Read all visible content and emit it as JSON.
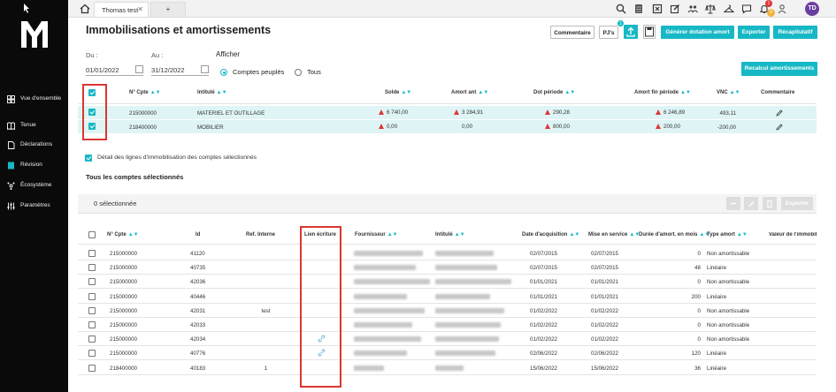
{
  "app": {
    "tab_title": "Thomas test",
    "tab_close": "✕",
    "tab_add": "+",
    "avatar_initials": "TD",
    "badge_notifications": "1",
    "badge_user": "0",
    "badge_pjs": "1"
  },
  "nav": [
    {
      "label": "Vue d'ensemble",
      "icon": "grid-icon"
    },
    {
      "label": "Tenue",
      "icon": "book-icon"
    },
    {
      "label": "Déclarations",
      "icon": "document-icon"
    },
    {
      "label": "Révision",
      "icon": "revision-icon"
    },
    {
      "label": "Écosystème",
      "icon": "ecosystem-icon"
    },
    {
      "label": "Paramètres",
      "icon": "sliders-icon"
    }
  ],
  "page": {
    "title": "Immobilisations et amortissements",
    "buttons": {
      "commentaire": "Commentaire",
      "pjs": "PJ's",
      "generer": "Générer dotation amort",
      "exporter": "Exporter",
      "recapitulatif": "Récapitulatif",
      "recalcul": "Recalcul amortissements"
    },
    "filters": {
      "du_label": "Du :",
      "au_label": "Au :",
      "du_value": "01/01/2022",
      "au_value": "31/12/2022",
      "afficher": "Afficher",
      "opt_comptes_peuples": "Comptes peuplés",
      "opt_tous": "Tous"
    }
  },
  "accounts_table": {
    "headers": [
      "N° Cpte",
      "Intitulé",
      "Solde",
      "Amort ant",
      "Dot période",
      "Amort fin période",
      "VNC",
      "Commentaire"
    ],
    "rows": [
      {
        "cpte": "215000000",
        "intitule": "MATERIEL ET OUTILLAGE",
        "solde": "6 740,00",
        "amort_ant": "3 284,91",
        "dot": "290,28",
        "amort_fin": "6 246,89",
        "vnc": "493,11"
      },
      {
        "cpte": "218400000",
        "intitule": "MOBILIER",
        "solde": "0,00",
        "amort_ant": "0,00",
        "dot": "800,00",
        "amort_fin": "200,00",
        "vnc": "-200,00"
      }
    ]
  },
  "details": {
    "checkbox_label": "Détail des lignes d'immobilisation des comptes sélectionnés",
    "section_title": "Tous les comptes sélectionnés",
    "selection_count": "0 sélectionnée",
    "exporter": "Exporter"
  },
  "lines_table": {
    "headers": [
      "N° Cpte",
      "Id",
      "Ref. Interne",
      "Lien écriture",
      "Fournisseur",
      "Intitulé",
      "Date d'acquisition",
      "Mise en service",
      "Durée d'amort. en mois",
      "Type amort",
      "Valeur de l'immobili"
    ],
    "rows": [
      {
        "cpte": "215000000",
        "id": "41120",
        "ref": "",
        "link": false,
        "date_acq": "02/07/2015",
        "mise": "02/07/2015",
        "duree": "0",
        "type": "Non amortissable"
      },
      {
        "cpte": "215000000",
        "id": "40735",
        "ref": "",
        "link": false,
        "date_acq": "02/07/2015",
        "mise": "02/07/2015",
        "duree": "48",
        "type": "Linéaire"
      },
      {
        "cpte": "215000000",
        "id": "42036",
        "ref": "",
        "link": false,
        "date_acq": "01/01/2021",
        "mise": "01/01/2021",
        "duree": "0",
        "type": "Non amortissable"
      },
      {
        "cpte": "215000000",
        "id": "40446",
        "ref": "",
        "link": false,
        "date_acq": "01/01/2021",
        "mise": "01/01/2021",
        "duree": "200",
        "type": "Linéaire"
      },
      {
        "cpte": "215000000",
        "id": "42031",
        "ref": "test",
        "link": false,
        "date_acq": "01/02/2022",
        "mise": "01/02/2022",
        "duree": "0",
        "type": "Non amortissable"
      },
      {
        "cpte": "215000000",
        "id": "42033",
        "ref": "",
        "link": false,
        "date_acq": "01/02/2022",
        "mise": "01/02/2022",
        "duree": "0",
        "type": "Non amortissable"
      },
      {
        "cpte": "215000000",
        "id": "42034",
        "ref": "",
        "link": true,
        "date_acq": "01/02/2022",
        "mise": "01/02/2022",
        "duree": "0",
        "type": "Non amortissable"
      },
      {
        "cpte": "215000000",
        "id": "40776",
        "ref": "",
        "link": true,
        "date_acq": "02/06/2022",
        "mise": "02/06/2022",
        "duree": "120",
        "type": "Linéaire"
      },
      {
        "cpte": "218400000",
        "id": "40183",
        "ref": "1",
        "link": false,
        "date_acq": "15/06/2022",
        "mise": "15/06/2022",
        "duree": "36",
        "type": "Linéaire"
      }
    ]
  }
}
